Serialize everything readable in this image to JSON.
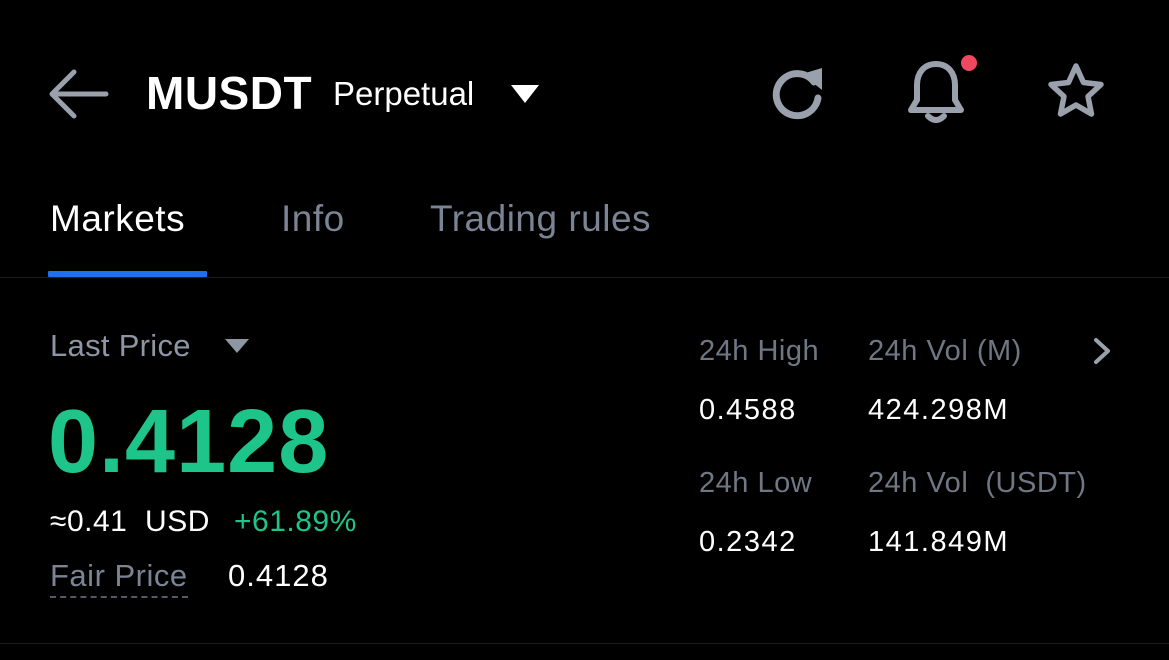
{
  "header": {
    "symbol": "MUSDT",
    "contract_type": "Perpetual",
    "icons": {
      "back": "arrow-left-icon",
      "dropdown": "caret-down-icon",
      "refresh": "refresh-icon",
      "notifications": "bell-icon",
      "favorite": "star-icon"
    },
    "notification_dot_color": "#f0485f"
  },
  "tabs": [
    {
      "label": "Markets",
      "active": true
    },
    {
      "label": "Info",
      "active": false
    },
    {
      "label": "Trading rules",
      "active": false
    }
  ],
  "price": {
    "label": "Last Price",
    "value": "0.4128",
    "approx_usd": "≈0.41  USD",
    "change": "+61.89%",
    "fair_label": "Fair Price",
    "fair_value": "0.4128"
  },
  "stats": {
    "high_label": "24h High",
    "high_value": "0.4588",
    "vol_m_label": "24h Vol (M)",
    "vol_m_value": "424.298M",
    "low_label": "24h Low",
    "low_value": "0.2342",
    "vol_usdt_label": "24h Vol  (USDT)",
    "vol_usdt_value": "141.849M"
  },
  "colors": {
    "background": "#000000",
    "positive": "#1dc58a",
    "accent": "#1f6ff2",
    "muted_text": "#7b8494",
    "icon": "#9aa1ad"
  }
}
